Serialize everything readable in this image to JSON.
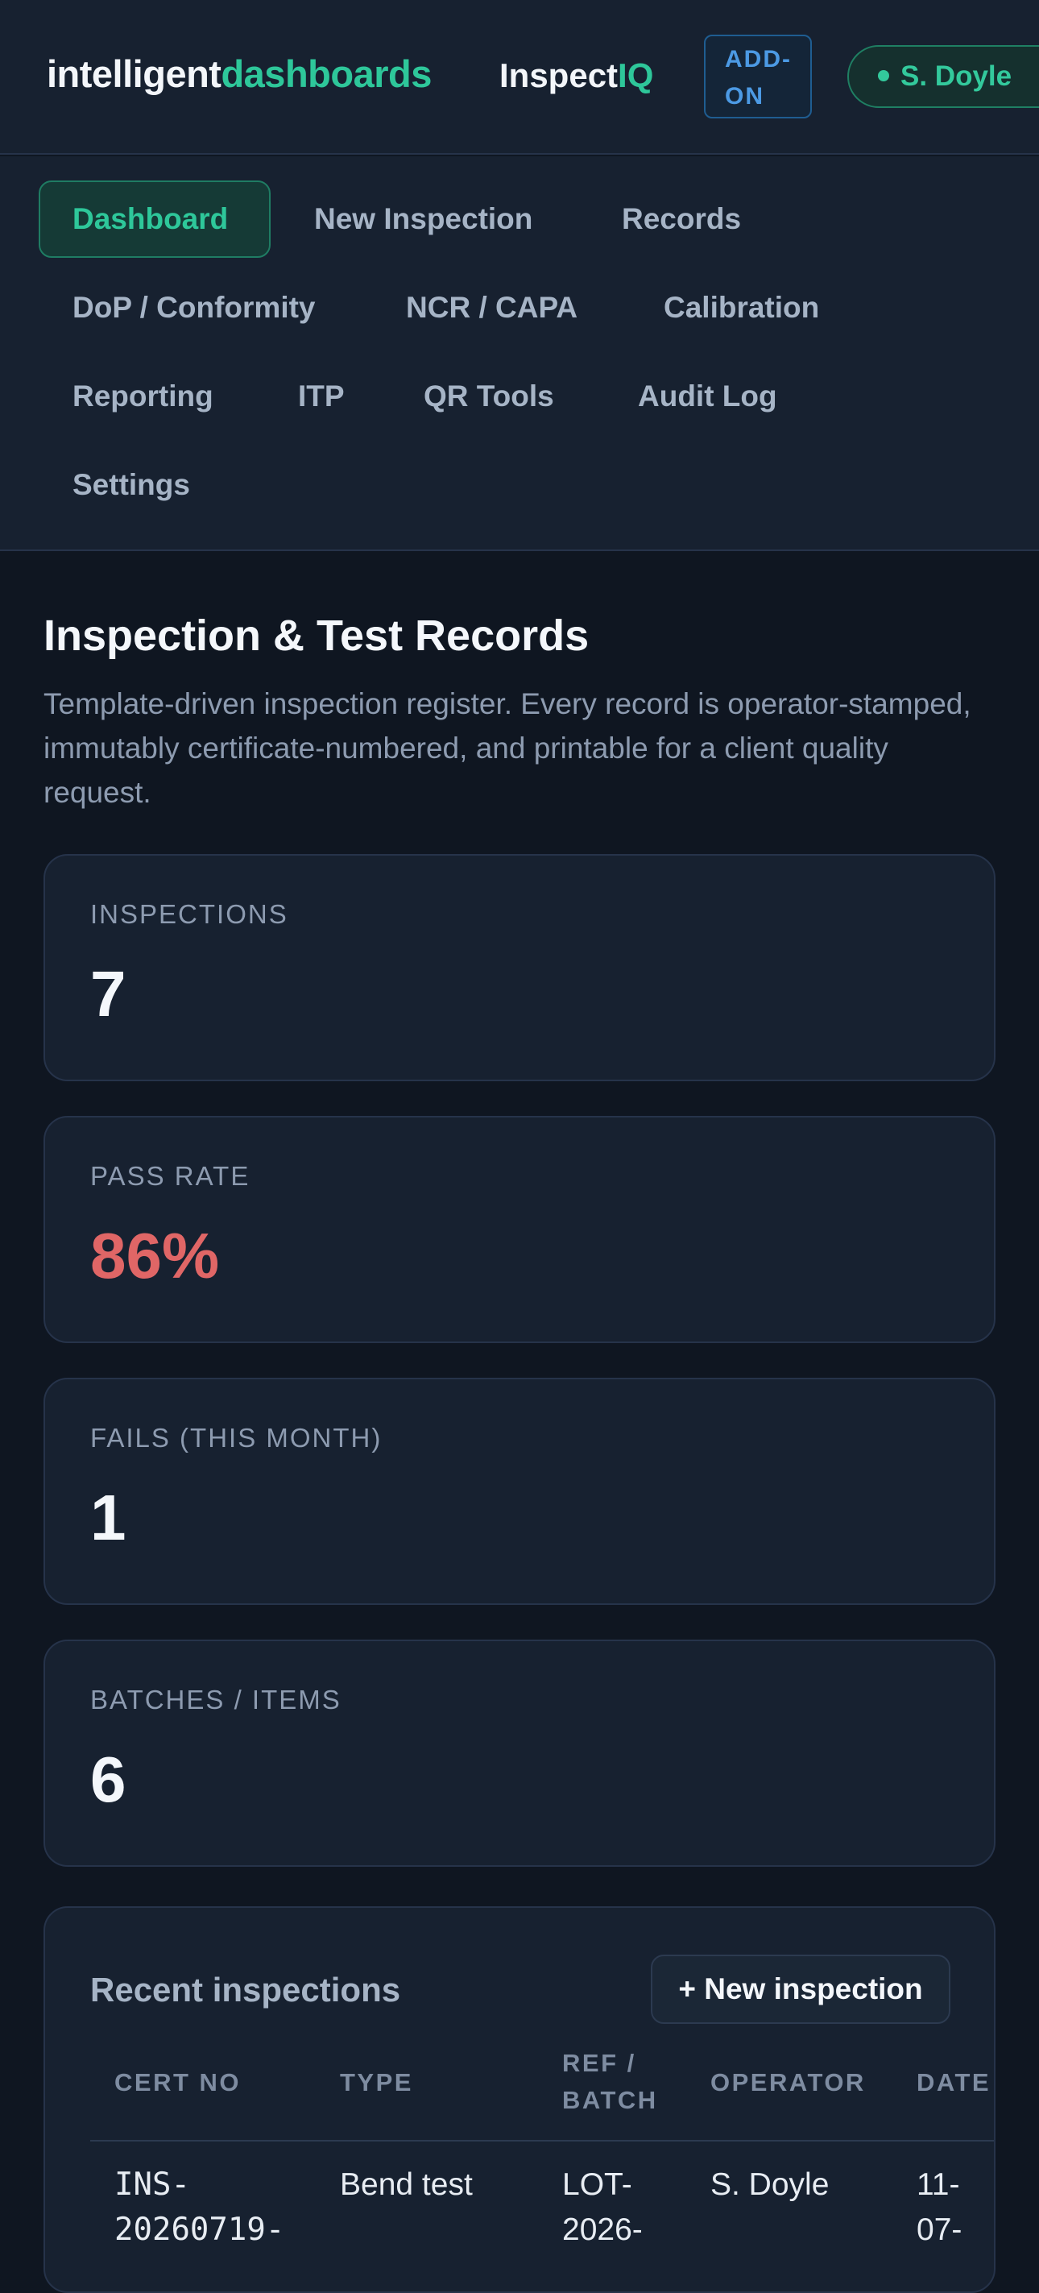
{
  "header": {
    "brand_part1": "intelligent",
    "brand_part2": "dashboards",
    "product_part1": "Inspect",
    "product_part2": "IQ",
    "addon_line1": "ADD-",
    "addon_line2": "ON",
    "user_name": "S. Doyle"
  },
  "nav": {
    "items": [
      {
        "label": "Dashboard",
        "active": true
      },
      {
        "label": "New Inspection"
      },
      {
        "label": "Records"
      },
      {
        "label": "DoP / Conformity"
      },
      {
        "label": "NCR / CAPA"
      },
      {
        "label": "Calibration"
      },
      {
        "label": "Reporting"
      },
      {
        "label": "ITP"
      },
      {
        "label": "QR Tools"
      },
      {
        "label": "Audit Log"
      },
      {
        "label": "Settings"
      }
    ]
  },
  "page": {
    "title": "Inspection & Test Records",
    "subtitle": "Template-driven inspection register. Every record is operator-stamped, immutably certificate-numbered, and printable for a client quality request."
  },
  "stats": [
    {
      "label": "INSPECTIONS",
      "value": "7"
    },
    {
      "label": "PASS RATE",
      "value": "86%",
      "status_color": "#e06666"
    },
    {
      "label": "FAILS (THIS MONTH)",
      "value": "1"
    },
    {
      "label": "BATCHES / ITEMS",
      "value": "6"
    }
  ],
  "recent": {
    "title": "Recent inspections",
    "new_button": "+ New inspection",
    "columns": [
      "CERT NO",
      "TYPE",
      "REF /\nBATCH",
      "OPERATOR",
      "DATE"
    ],
    "rows": [
      {
        "cert_no": "INS-\n20260719-",
        "type": "Bend test",
        "ref": "LOT-\n2026-",
        "operator": "S. Doyle",
        "date": "11-\n07-"
      }
    ]
  },
  "colors": {
    "background": "#0f1621",
    "panel": "#172130",
    "accent": "#2ec79a",
    "addon_blue": "#4c9ae4",
    "danger": "#e06666"
  }
}
